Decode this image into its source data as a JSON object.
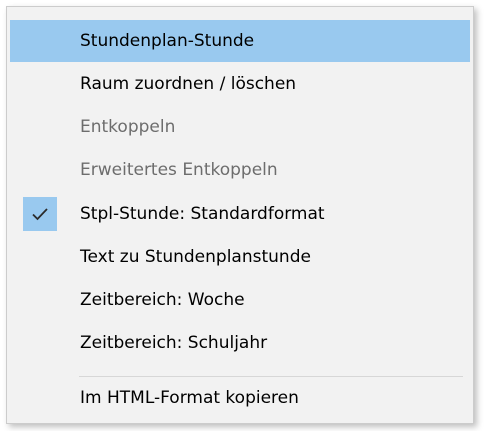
{
  "menu": {
    "items": [
      {
        "label": "Stundenplan-Stunde",
        "state": "highlighted"
      },
      {
        "label": "Raum zuordnen / löschen",
        "state": "enabled"
      },
      {
        "label": "Entkoppeln",
        "state": "disabled"
      },
      {
        "label": "Erweitertes Entkoppeln",
        "state": "disabled"
      },
      {
        "label": "Stpl-Stunde: Standardformat",
        "state": "checked",
        "icon": "checkmark-icon"
      },
      {
        "label": "Text zu Stundenplanstunde",
        "state": "enabled"
      },
      {
        "label": "Zeitbereich: Woche",
        "state": "enabled"
      },
      {
        "label": "Zeitbereich: Schuljahr",
        "state": "enabled"
      },
      {
        "label": "Im HTML-Format kopieren",
        "state": "enabled"
      }
    ]
  },
  "colors": {
    "highlight": "#99c9ef",
    "background": "#f2f2f2",
    "disabled_text": "#6d6d6d",
    "text": "#000000"
  }
}
